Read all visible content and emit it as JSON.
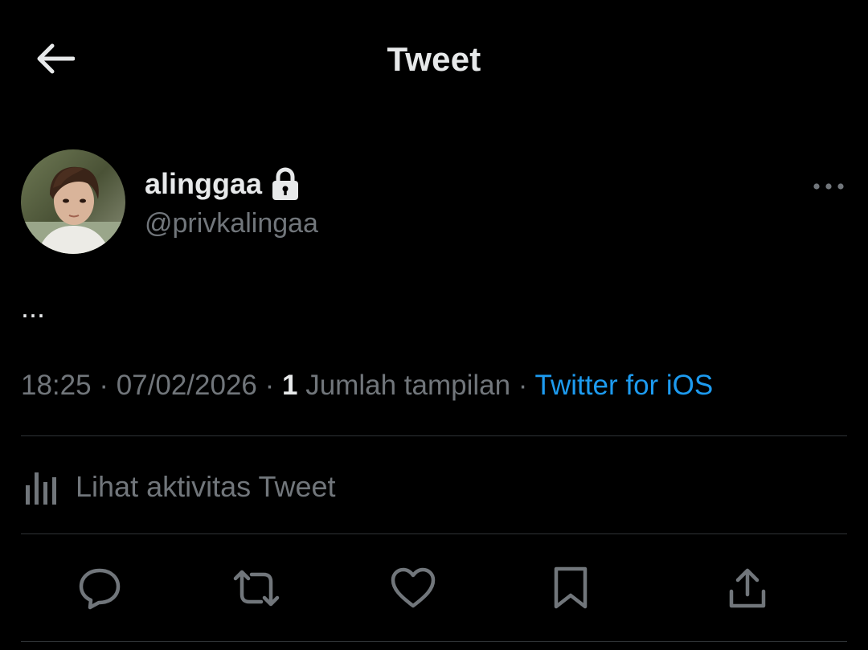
{
  "header": {
    "title": "Tweet",
    "back_icon": "arrow-left-icon"
  },
  "tweet": {
    "author": {
      "display_name": "alinggaa",
      "handle": "@privkalingaa",
      "protected_icon": "lock-icon"
    },
    "text": "...",
    "time": "18:25",
    "date": "07/02/2026",
    "view_count": "1",
    "view_label": "Jumlah tampilan",
    "separator": "·",
    "source": "Twitter for iOS"
  },
  "activity": {
    "label": "Lihat aktivitas Tweet",
    "icon": "analytics-icon"
  },
  "actions": {
    "reply_icon": "reply-icon",
    "retweet_icon": "retweet-icon",
    "like_icon": "heart-icon",
    "bookmark_icon": "bookmark-icon",
    "share_icon": "share-icon"
  },
  "colors": {
    "background": "#000000",
    "text_primary": "#e7e9ea",
    "text_secondary": "#71767b",
    "link": "#1d9bf0",
    "divider": "#2f3336"
  }
}
